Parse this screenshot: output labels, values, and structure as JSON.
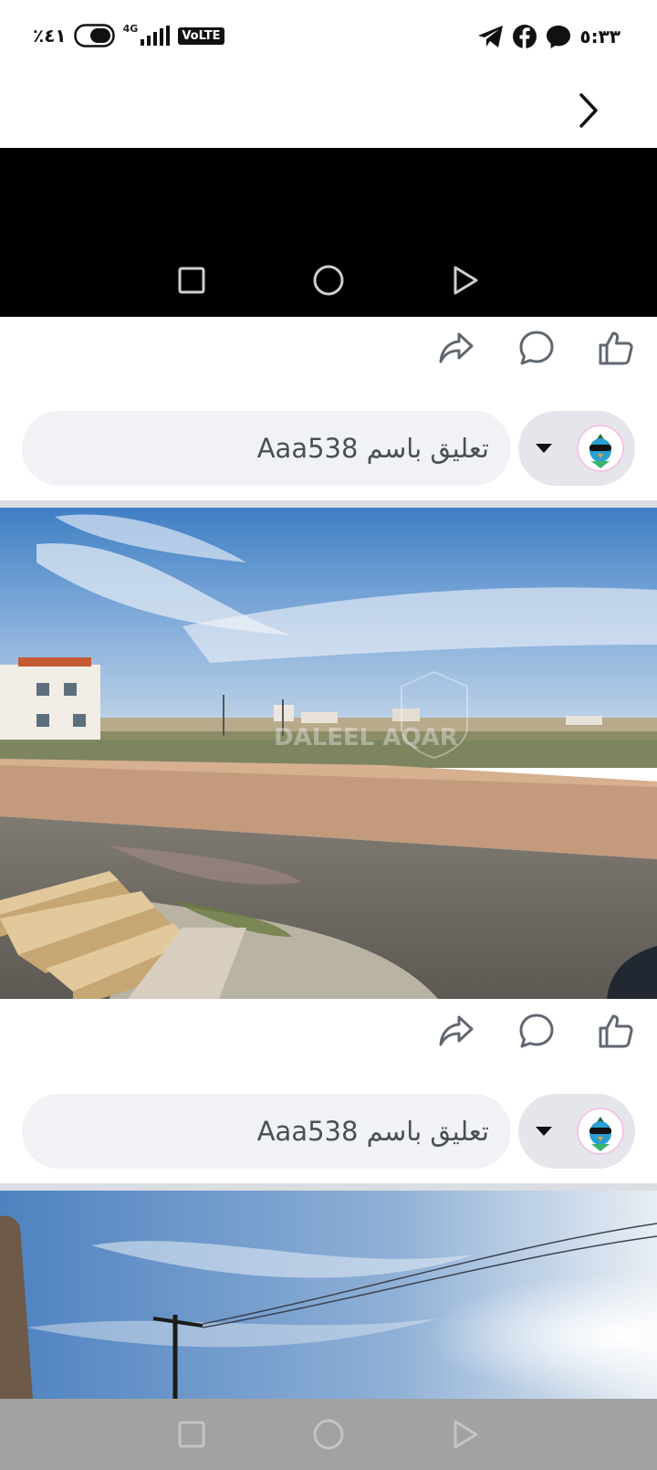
{
  "status_bar": {
    "time": "٥:٣٣",
    "battery": "٪٤١",
    "network": "4G",
    "volte": "VoLTE",
    "icons": [
      "telegram-icon",
      "facebook-icon",
      "messenger-icon",
      "battery-icon",
      "signal-icon"
    ]
  },
  "top_bar": {
    "back_icon": "chevron-right-icon"
  },
  "posts": [
    {
      "comment_placeholder": "تعليق باسم Aaa538"
    },
    {
      "comment_placeholder": "تعليق باسم Aaa538"
    }
  ],
  "photo1": {
    "watermark": "DALEEL AQAR"
  },
  "colors": {
    "comment_bg": "#f0f2f5",
    "avatar_pill_bg": "#e4e6eb",
    "divider": "#dadde1",
    "nav_overlay": "#a2a2a2"
  }
}
